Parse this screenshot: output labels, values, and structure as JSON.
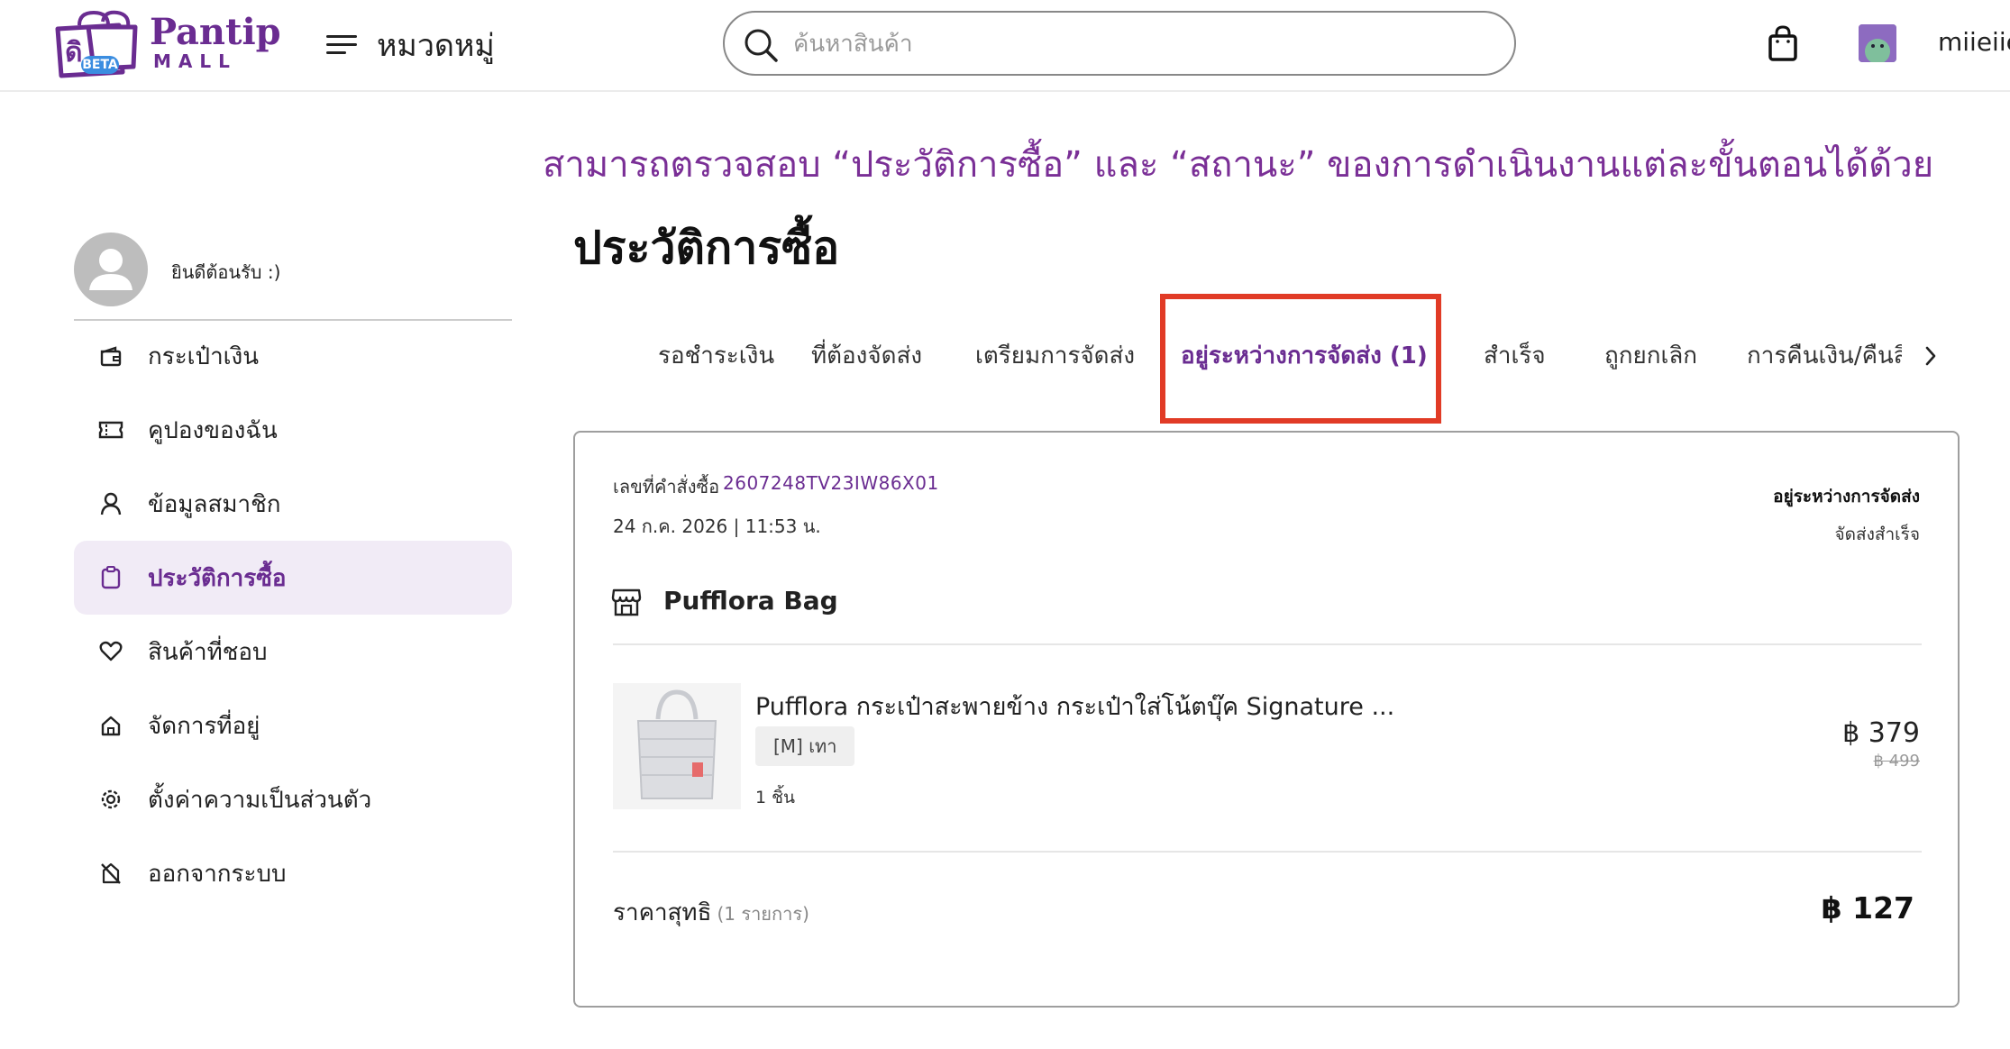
{
  "header": {
    "brand_name": "Pantip",
    "brand_sub": "MALL",
    "beta_badge": "BETA",
    "menu_label": "หมวดหมู่",
    "search_placeholder": "ค้นหาสินค้า",
    "username": "miieiie"
  },
  "banner": "สามารถตรวจสอบ “ประวัติการซื้อ” และ “สถานะ” ของการดำเนินงานแต่ละขั้นตอนได้ด้วย",
  "sidebar": {
    "welcome": "ยินดีต้อนรับ :)",
    "items": [
      {
        "label": "กระเป๋าเงิน",
        "icon": "wallet-icon"
      },
      {
        "label": "คูปองของฉัน",
        "icon": "ticket-icon"
      },
      {
        "label": "ข้อมูลสมาชิก",
        "icon": "user-icon"
      },
      {
        "label": "ประวัติการซื้อ",
        "icon": "clipboard-icon",
        "active": true
      },
      {
        "label": "สินค้าที่ชอบ",
        "icon": "heart-icon"
      },
      {
        "label": "จัดการที่อยู่",
        "icon": "home-icon"
      },
      {
        "label": "ตั้งค่าความเป็นส่วนตัว",
        "icon": "gear-icon"
      },
      {
        "label": "ออกจากระบบ",
        "icon": "logout-icon"
      }
    ]
  },
  "main": {
    "page_title": "ประวัติการซื้อ",
    "tabs": [
      {
        "label": "รอชำระเงิน"
      },
      {
        "label": "ที่ต้องจัดส่ง"
      },
      {
        "label": "เตรียมการจัดส่ง"
      },
      {
        "label": "อยู่ระหว่างการจัดส่ง (1)",
        "active": true
      },
      {
        "label": "สำเร็จ"
      },
      {
        "label": "ถูกยกเลิก"
      },
      {
        "label": "การคืนเงิน/คืนสินค้า"
      }
    ]
  },
  "order": {
    "order_label": "เลขที่คำสั่งซื้อ",
    "order_number": "2607248TV23IW86X01",
    "date": "24 ก.ค. 2026 | 11:53 น.",
    "status": "อยู่ระหว่างการจัดส่ง",
    "status_sub": "จัดส่งสำเร็จ",
    "shop_name": "Pufflora Bag",
    "product_name": "Pufflora กระเป๋าสะพายข้าง กระเป๋าใส่โน้ตบุ๊ค Signature ...",
    "variant": "[M] เทา",
    "quantity": "1 ชิ้น",
    "price": "฿ 379",
    "original_price": "฿ 499",
    "total_label": "ราคาสุทธิ",
    "total_count": "(1 รายการ)",
    "total_price": "฿ 127"
  },
  "colors": {
    "brand": "#6a2c91",
    "banner_text": "#7a2f96",
    "highlight": "#e13b26",
    "active_bg": "#f1ebf6"
  }
}
